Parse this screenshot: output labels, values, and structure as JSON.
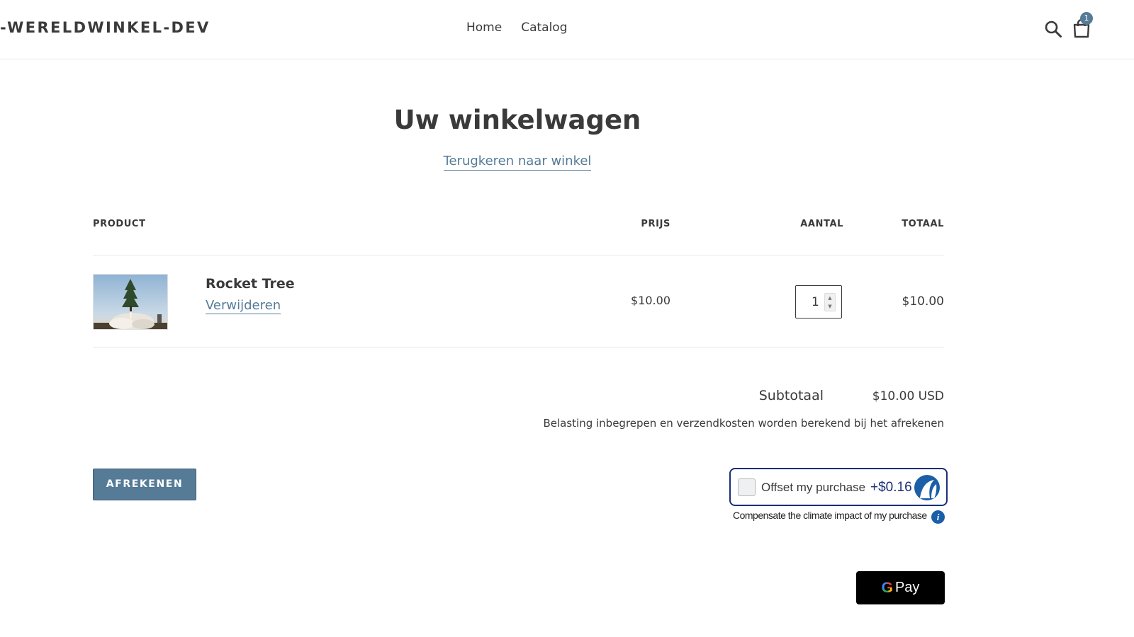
{
  "header": {
    "logo_text": "-WERELDWINKEL-DEV",
    "nav": [
      {
        "label": "Home"
      },
      {
        "label": "Catalog"
      }
    ],
    "cart_count": "1",
    "icons": {
      "search": "search-icon",
      "cart": "shopping-bag-icon"
    }
  },
  "cart": {
    "title": "Uw winkelwagen",
    "continue_link": "Terugkeren naar winkel",
    "columns": {
      "product": "PRODUCT",
      "price": "PRIJS",
      "quantity": "AANTAL",
      "total": "TOTAAL"
    },
    "items": [
      {
        "name": "Rocket Tree",
        "remove_label": "Verwijderen",
        "price": "$10.00",
        "quantity": "1",
        "total": "$10.00"
      }
    ],
    "subtotal_label": "Subtotaal",
    "subtotal_value": "$10.00 USD",
    "tax_note": "Belasting inbegrepen en verzendkosten worden berekend bij het afrekenen",
    "checkout_label": "AFREKENEN"
  },
  "offset": {
    "label": "Offset my purchase",
    "price": "+$0.16",
    "note": "Compensate the climate impact of my purchase",
    "info_symbol": "i"
  },
  "gpay": {
    "g": "G",
    "label": "Pay"
  },
  "colors": {
    "accent": "#557b97",
    "text": "#3a3a3a",
    "offset_border": "#1b2e78"
  }
}
